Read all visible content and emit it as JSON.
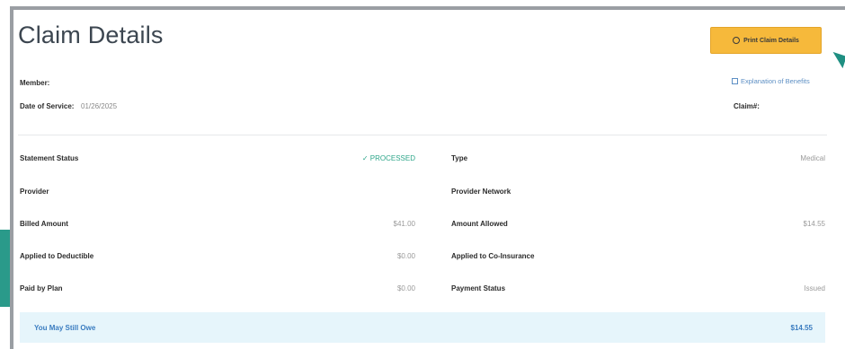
{
  "header": {
    "title": "Claim Details",
    "print_label": "Print Claim Details"
  },
  "summary": {
    "member_label": "Member:",
    "date_label": "Date of Service:",
    "date_value": "01/26/2025",
    "eob_label": "Explanation of Benefits",
    "claim_label": "Claim#:"
  },
  "details": {
    "statement_status_label": "Statement Status",
    "statement_status_value": "✓ PROCESSED",
    "type_label": "Type",
    "type_value": "Medical",
    "provider_label": "Provider",
    "provider_network_label": "Provider Network",
    "billed_label": "Billed Amount",
    "billed_value": "$41.00",
    "allowed_label": "Amount Allowed",
    "allowed_value": "$14.55",
    "deductible_label": "Applied to Deductible",
    "deductible_value": "$0.00",
    "coins_label": "Applied to Co-Insurance",
    "paid_label": "Paid by Plan",
    "paid_value": "$0.00",
    "payment_status_label": "Payment Status",
    "payment_status_value": "Issued"
  },
  "owe": {
    "label": "You May Still Owe",
    "value": "$14.55"
  },
  "colors": {
    "accent_button": "#f6b93b",
    "link": "#5d8fc4",
    "processed": "#2ea68a",
    "owe_bg": "#e6f5fb"
  }
}
